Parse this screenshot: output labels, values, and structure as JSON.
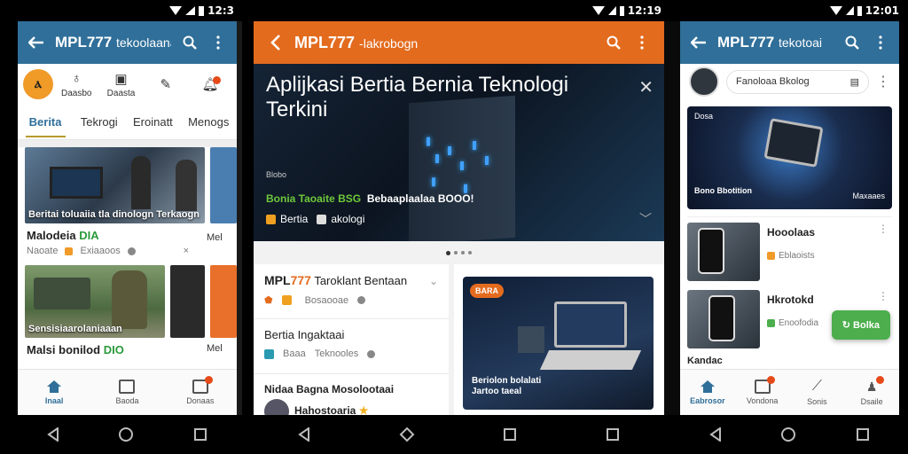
{
  "statusbars": [
    "12:3",
    "12:19",
    "12:01"
  ],
  "phone1": {
    "appbar": {
      "title": "MPL777",
      "subtitle": "tekoolaanaon"
    },
    "quick": [
      {
        "label": "Daasbo",
        "icon": "person-icon"
      },
      {
        "label": "Daasta",
        "icon": "card-icon"
      },
      {
        "label": "",
        "icon": "pen-icon"
      },
      {
        "label": "",
        "icon": "bell-icon"
      }
    ],
    "tabs": [
      "Berita",
      "Tekrogi",
      "Eroinatt",
      "Menogs"
    ],
    "card1": {
      "caption": "Beritai toluaiia tla dinologn Terkaogn",
      "title": "Malodeia",
      "title_green": "DIA",
      "meta1": "Naoate",
      "meta2": "Exiaaoos"
    },
    "card2": {
      "caption": "Sensisiaarolaniaaan",
      "title": "Malsi bonilod",
      "title_green": "DIO"
    },
    "side_label": "Mel",
    "bottom": [
      "Inaal",
      "Baoda",
      "Donaas"
    ]
  },
  "phone2": {
    "appbar": {
      "title": "MPL777",
      "subtitle": "-lakrobogn"
    },
    "hero": {
      "title": "Aplijkasi Bertia Bernia Teknologi Terkini",
      "small": "Blobo",
      "sub_green": "Bonia Taoaite BSG",
      "sub_white": "Bebaaplaalaa BOOO!",
      "tag1": "Bertia",
      "tag2": "akologi"
    },
    "list": [
      {
        "title_a": "MPL",
        "title_b": "777",
        "title_c": "Taroklant Bentaan",
        "meta1": "Bosaooae"
      },
      {
        "title_a": "",
        "title_b": "",
        "title_c": "Bertia Ingaktaai",
        "meta1": "Baaa",
        "meta2": "Teknooles"
      }
    ],
    "list3": {
      "title": "Nidaa Bagna Mosolootaai",
      "sub": "Hahostoaria"
    },
    "feature": {
      "pill": "BARA",
      "caption": "Beriolon bolalati Jartoo taeal"
    }
  },
  "phone3": {
    "appbar": {
      "title": "MPL777",
      "subtitle": "tekotoai"
    },
    "profile": {
      "chip": "Fanoloaa Bkolog"
    },
    "hero": {
      "label": "Dosa",
      "caption1": "Bono Bbotition",
      "caption2": "Maxaaes"
    },
    "items": [
      {
        "title": "Hooolaas",
        "meta": "Eblaoists"
      },
      {
        "title": "Hkrotokd",
        "meta": "Enoofodia"
      }
    ],
    "fab": "Bolka",
    "kandac": "Kandac",
    "bottom": [
      "Eabrosor",
      "Vondona",
      "Sonis",
      "Dsaile"
    ]
  },
  "colors": {
    "blue": "#2f6f99",
    "orange": "#e36b1e",
    "green": "#4cae4c"
  }
}
